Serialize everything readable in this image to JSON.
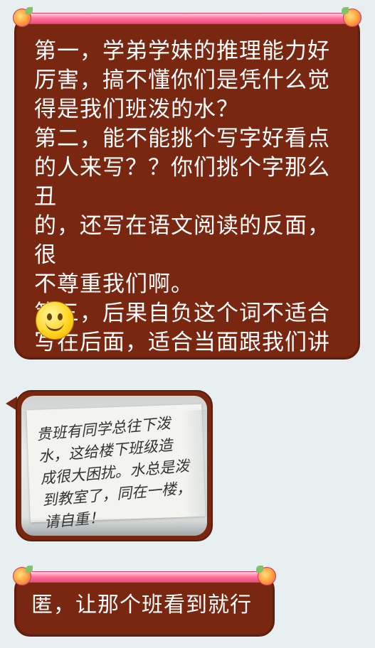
{
  "messages": [
    {
      "type": "text",
      "text": "第一，学弟学妹的推理能力好\n厉害，搞不懂你们是凭什么觉\n得是我们班泼的水？\n第二，能不能挑个写字好看点\n的人来写？？你们挑个字那么丑\n的，还写在语文阅读的反面，很\n不尊重我们啊。\n第三，后果自负这个词不适合\n写在后面，适合当面跟我们讲",
      "emoji": "smiley-face"
    },
    {
      "type": "image",
      "handwritten_note": "贵班有同学总往下泼\n水，这给楼下班级造\n成很大困扰。水总是泼\n到教室了，同在一楼，\n请自重！"
    },
    {
      "type": "text",
      "text": "匿，让那个班看到就行"
    }
  ],
  "colors": {
    "background": "#e7eff1",
    "bubble": "#7a2712",
    "bubble_text": "#ffffff",
    "ribbon": "#ff6f9a"
  }
}
